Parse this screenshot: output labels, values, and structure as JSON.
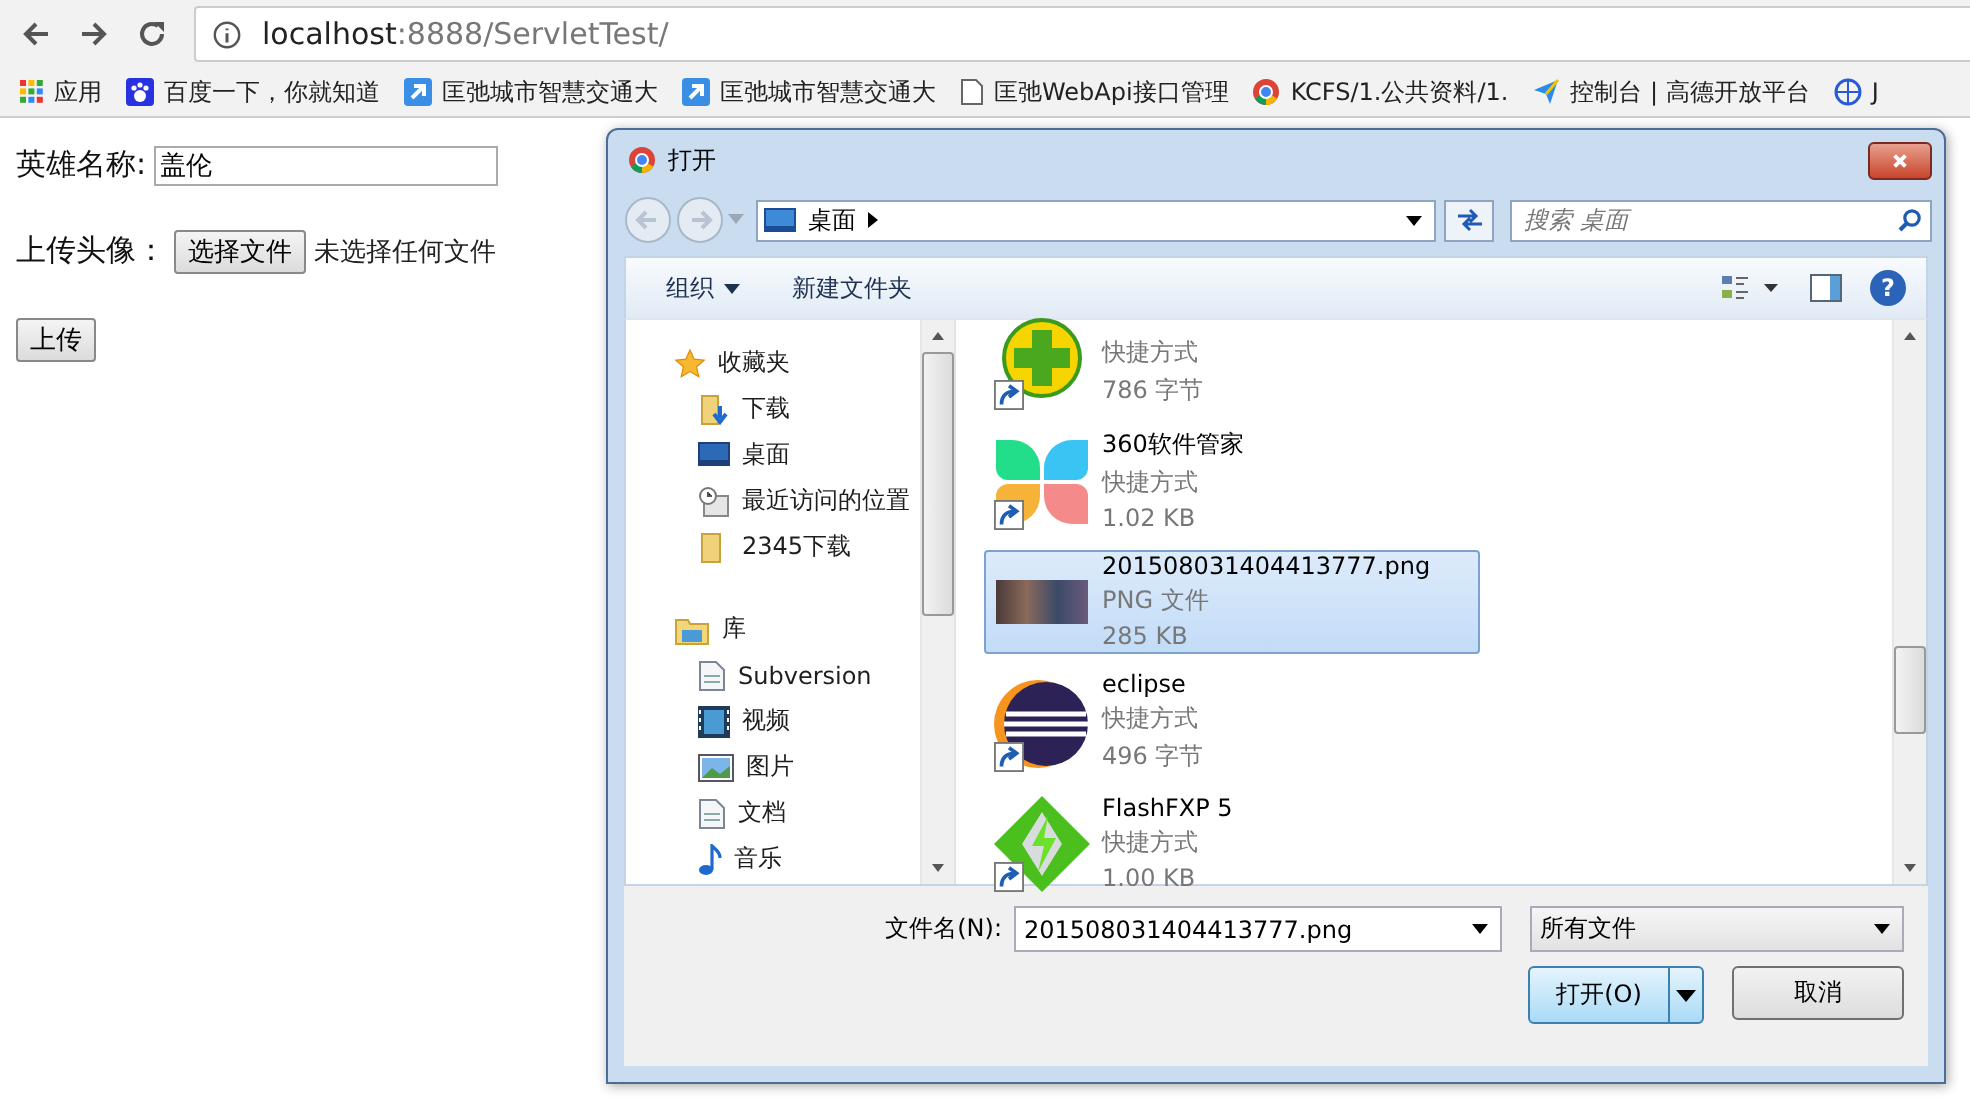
{
  "browser": {
    "address": {
      "host": "localhost",
      "rest": ":8888/ServletTest/"
    },
    "bookmarks": [
      {
        "kind": "apps",
        "label": "应用"
      },
      {
        "kind": "paw",
        "label": "百度一下，你就知道"
      },
      {
        "kind": "arrow",
        "label": "匡弛城市智慧交通大"
      },
      {
        "kind": "arrow",
        "label": "匡弛城市智慧交通大"
      },
      {
        "kind": "page",
        "label": "匡弛WebApi接口管理"
      },
      {
        "kind": "chrome",
        "label": "KCFS/1.公共资料/1."
      },
      {
        "kind": "plane",
        "label": "控制台 | 高德开放平台"
      },
      {
        "kind": "globe",
        "label": "J"
      }
    ]
  },
  "form": {
    "name_label": "英雄名称:",
    "name_value": "盖伦",
    "avatar_label": "上传头像：",
    "choose_button": "选择文件",
    "no_file_text": "未选择任何文件",
    "submit_button": "上传"
  },
  "dialog": {
    "title": "打开",
    "location": "桌面",
    "search_placeholder": "搜索 桌面",
    "toolbar": {
      "organize": "组织",
      "new_folder": "新建文件夹",
      "help": "?"
    },
    "nav": [
      {
        "kind": "star",
        "label": "收藏夹",
        "children": [
          {
            "kind": "download",
            "label": "下载"
          },
          {
            "kind": "desktop",
            "label": "桌面"
          },
          {
            "kind": "recent",
            "label": "最近访问的位置"
          },
          {
            "kind": "folder",
            "label": "2345下载"
          }
        ]
      },
      {
        "kind": "library",
        "label": "库",
        "children": [
          {
            "kind": "doc",
            "label": "Subversion"
          },
          {
            "kind": "video",
            "label": "视频"
          },
          {
            "kind": "picture",
            "label": "图片"
          },
          {
            "kind": "doc",
            "label": "文档"
          },
          {
            "kind": "music",
            "label": "音乐"
          }
        ]
      }
    ],
    "files": [
      {
        "kind": "guard",
        "shortcut": true,
        "type": "快捷方式",
        "size": "786 字节",
        "selected": false
      },
      {
        "kind": "petals",
        "shortcut": true,
        "name": "360软件管家",
        "type": "快捷方式",
        "size": "1.02 KB",
        "selected": false
      },
      {
        "kind": "photo",
        "shortcut": false,
        "name": "201508031404413777.png",
        "type": "PNG 文件",
        "size": "285 KB",
        "selected": true
      },
      {
        "kind": "eclipse",
        "shortcut": true,
        "name": "eclipse",
        "type": "快捷方式",
        "size": "496 字节",
        "selected": false
      },
      {
        "kind": "flash",
        "shortcut": true,
        "name": "FlashFXP 5",
        "type": "快捷方式",
        "size": "1.00 KB",
        "selected": false
      }
    ],
    "filename_label": "文件名(N):",
    "filename_value": "201508031404413777.png",
    "filetype": "所有文件",
    "open_button": "打开(O)",
    "cancel_button": "取消"
  }
}
